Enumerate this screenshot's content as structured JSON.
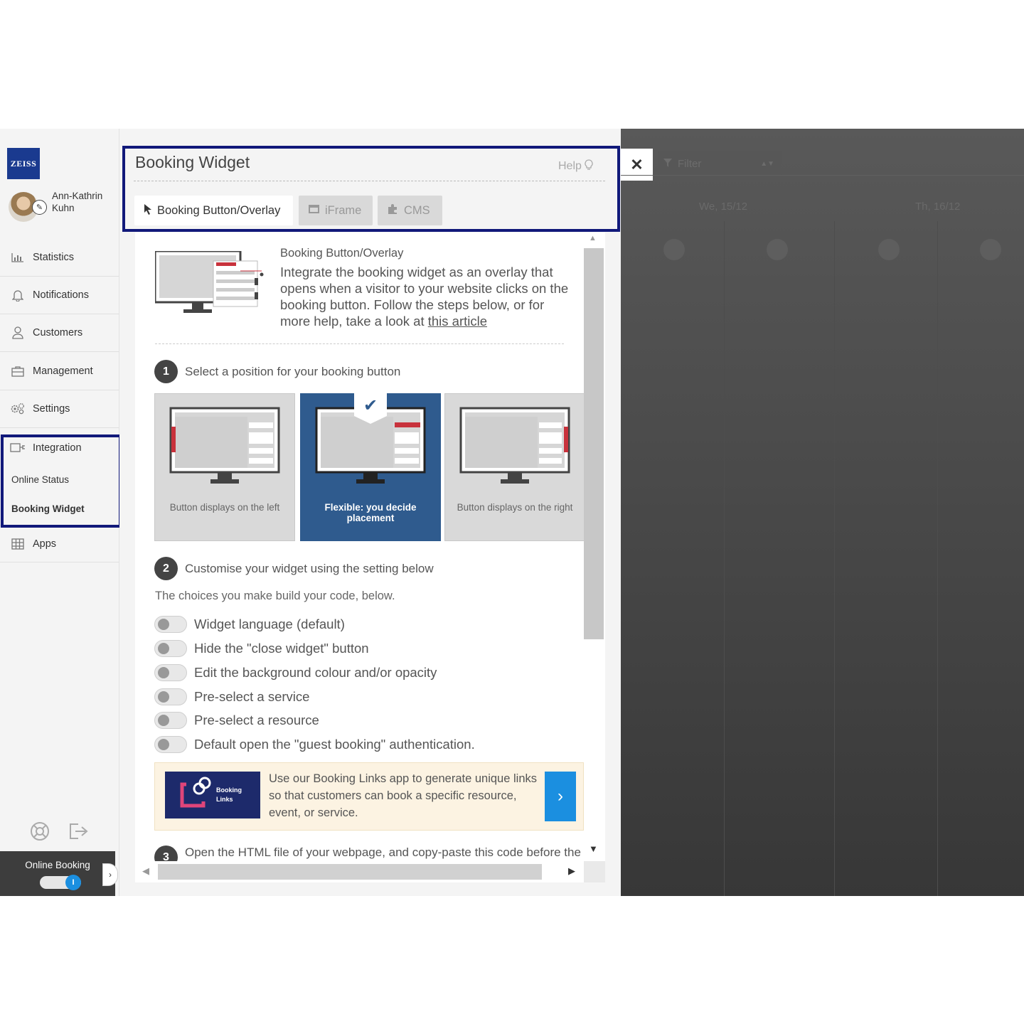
{
  "sidebar": {
    "logo_text": "ZEISS",
    "user_name": "Ann-Kathrin Kuhn",
    "nav": [
      {
        "label": "Statistics",
        "icon": "bar-chart-icon"
      },
      {
        "label": "Notifications",
        "icon": "bell-icon"
      },
      {
        "label": "Customers",
        "icon": "user-icon"
      },
      {
        "label": "Management",
        "icon": "briefcase-icon"
      },
      {
        "label": "Settings",
        "icon": "gears-icon"
      },
      {
        "label": "Integration",
        "icon": "plug-icon"
      },
      {
        "label": "Apps",
        "icon": "grid-icon"
      }
    ],
    "subitems": [
      "Online Status",
      "Booking Widget"
    ],
    "online_booking_label": "Online Booking",
    "online_booking_toggle_glyph": "I",
    "highlight_color": "#11197a"
  },
  "panel": {
    "title": "Booking Widget",
    "help": "Help",
    "tabs": [
      {
        "label": "Booking Button/Overlay",
        "active": true
      },
      {
        "label": "iFrame",
        "active": false
      },
      {
        "label": "CMS",
        "active": false
      }
    ],
    "intro": {
      "title": "Booking Button/Overlay",
      "text": "Integrate the booking widget as an overlay that opens when a visitor to your website clicks on the booking button. Follow the steps below, or for more help, take a look at ",
      "link": "this article"
    },
    "step1": {
      "number": "1",
      "text": "Select a position for your booking button"
    },
    "positions": [
      {
        "caption": "Button displays on the left",
        "selected": false
      },
      {
        "caption": "Flexible: you decide placement",
        "selected": true
      },
      {
        "caption": "Button displays on the right",
        "selected": false
      }
    ],
    "step2": {
      "number": "2",
      "text": "Customise your widget using the setting below"
    },
    "choices_note": "The choices you make build your code, below.",
    "options": [
      "Widget language (default)",
      "Hide the \"close widget\" button",
      "Edit the background colour and/or opacity",
      "Pre-select a service",
      "Pre-select a resource",
      "Default open the \"guest booking\" authentication."
    ],
    "promo": {
      "logo_text": "Booking Links",
      "text": "Use our Booking Links app to generate unique links so that customers can book a specific resource, event, or service."
    },
    "step3": {
      "number": "3",
      "text": "Open the HTML file of your webpage, and copy-paste this code before the"
    }
  },
  "overlay": {
    "filter_placeholder": "Filter",
    "days": [
      "We, 15/12",
      "Th, 16/12"
    ]
  },
  "colors": {
    "accent_blue": "#1b8fe0",
    "selected_card": "#2f5b8e",
    "highlight_border": "#11197a"
  }
}
